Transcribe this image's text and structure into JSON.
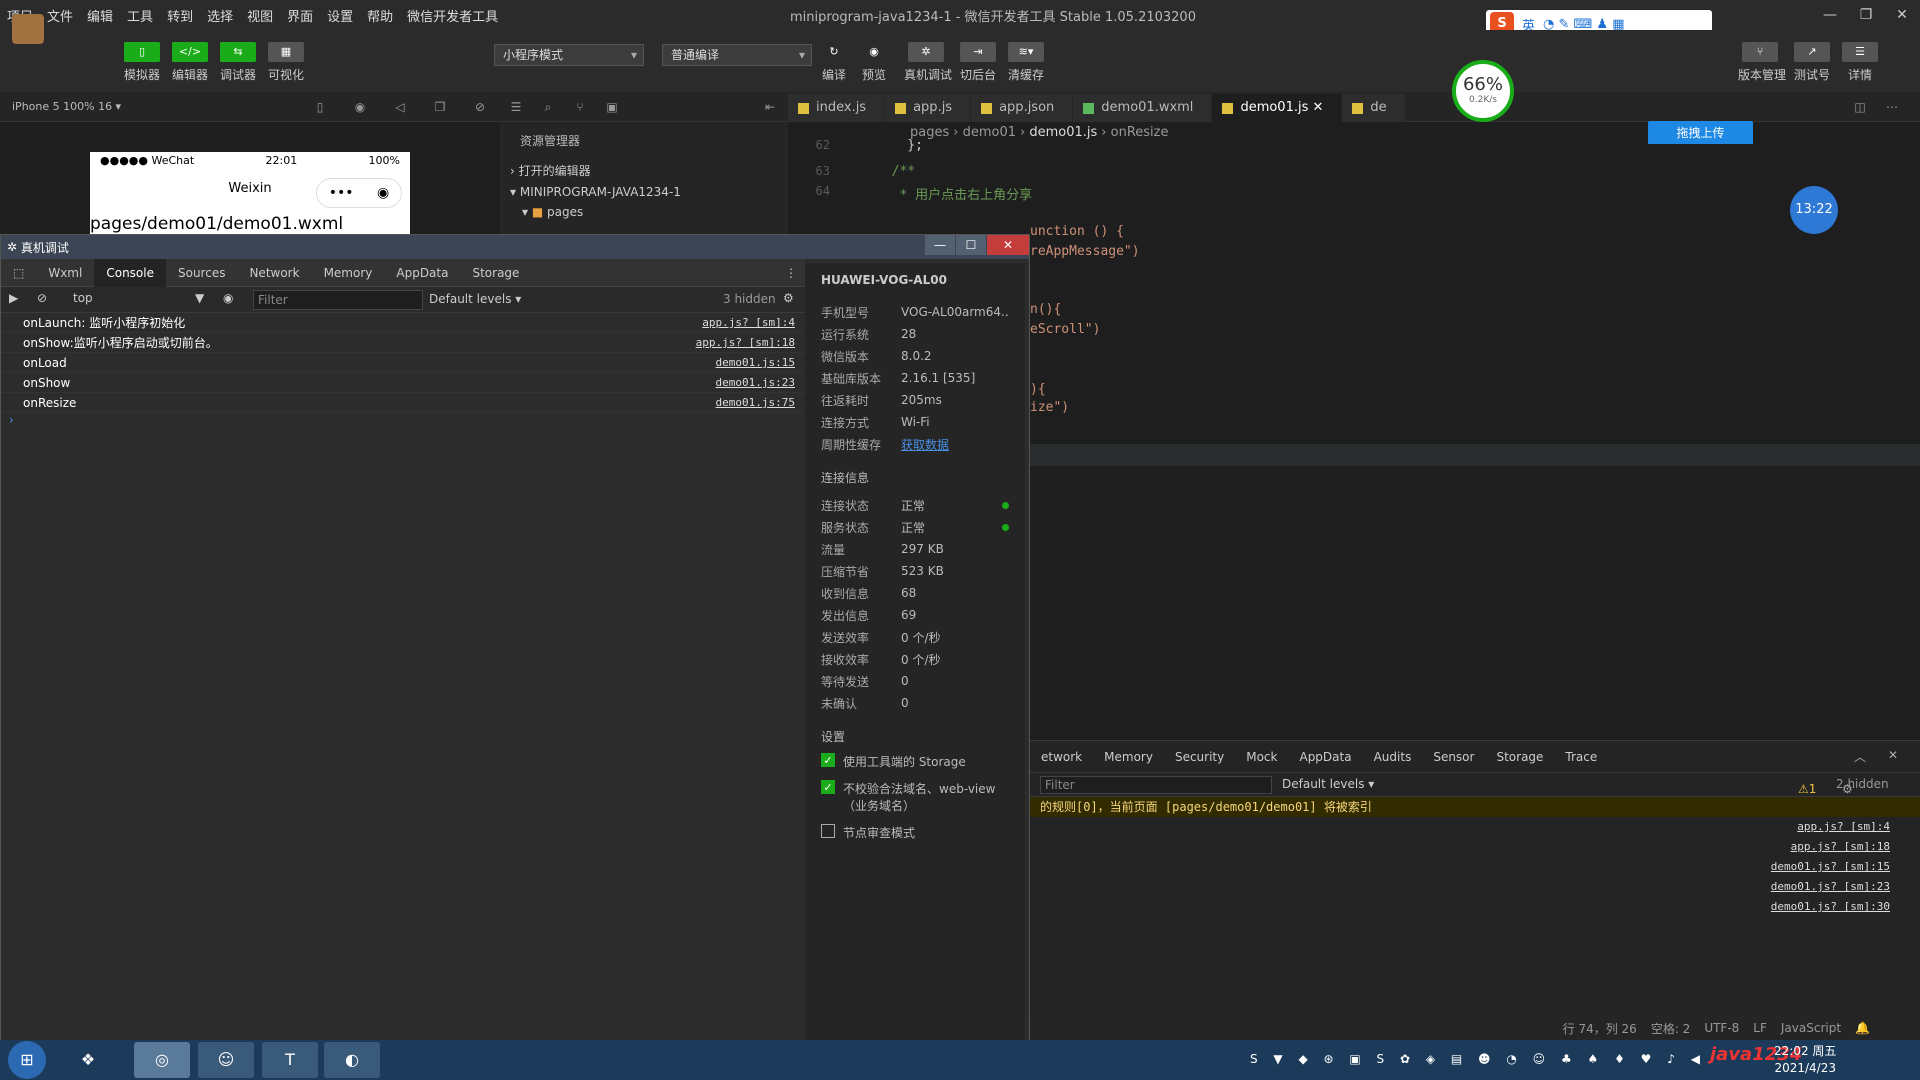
{
  "menu": [
    "项目",
    "文件",
    "编辑",
    "工具",
    "转到",
    "选择",
    "视图",
    "界面",
    "设置",
    "帮助",
    "微信开发者工具"
  ],
  "window_title": "miniprogram-java1234-1 - 微信开发者工具 Stable 1.05.2103200",
  "ime": {
    "label": "英"
  },
  "toolbar": {
    "simulator": "模拟器",
    "editor": "编辑器",
    "debugger": "调试器",
    "visual": "可视化",
    "mode": "小程序模式",
    "compile_mode": "普通编译",
    "compile": "编译",
    "preview": "预览",
    "real_debug": "真机调试",
    "backstage": "切后台",
    "clear_cache": "清缓存",
    "version": "版本管理",
    "test": "测试号",
    "detail": "详情"
  },
  "device": "iPhone 5 100% 16 ▾",
  "tabs": [
    {
      "label": "index.js",
      "color": "#e0c040"
    },
    {
      "label": "app.js",
      "color": "#e0c040"
    },
    {
      "label": "app.json",
      "color": "#e0c040"
    },
    {
      "label": "demo01.wxml",
      "color": "#5cb85c"
    },
    {
      "label": "demo01.js",
      "color": "#e0c040"
    },
    {
      "label": "de",
      "color": "#e0c040"
    }
  ],
  "breadcrumb": [
    "pages",
    "demo01",
    "demo01.js",
    "onResize"
  ],
  "upload": "拖拽上传",
  "perf": {
    "percent": "66%",
    "speed": "0.2K/s"
  },
  "clock": "13:22",
  "phone": {
    "carrier": "●●●●● WeChat",
    "time": "22:01",
    "battery": "100%",
    "title": "Weixin",
    "path": "pages/demo01/demo01.wxml"
  },
  "explorer": {
    "header": "资源管理器",
    "open_editors": "打开的编辑器",
    "project": "MINIPROGRAM-JAVA1234-1",
    "folder": "pages"
  },
  "code": [
    {
      "n": "62",
      "t": "    };"
    },
    {
      "n": "63",
      "t": "  /**"
    },
    {
      "n": "64",
      "t": "   * 用户点击右上角分享"
    },
    {
      "n": "",
      "t": "unction () {"
    },
    {
      "n": "",
      "t": "reAppMessage\")"
    },
    {
      "n": "",
      "t": "n(){"
    },
    {
      "n": "",
      "t": "eScroll\")"
    },
    {
      "n": "",
      "t": "){"
    },
    {
      "n": "",
      "t": "ize\")"
    }
  ],
  "debug": {
    "title": "真机调试",
    "tabs": [
      "Wxml",
      "Console",
      "Sources",
      "Network",
      "Memory",
      "AppData",
      "Storage"
    ],
    "context": "top",
    "filter": "Filter",
    "levels": "Default levels ▾",
    "hidden": "3 hidden",
    "logs": [
      {
        "msg": "onLaunch: 监听小程序初始化",
        "src": "app.js? [sm]:4"
      },
      {
        "msg": "onShow:监听小程序启动或切前台。",
        "src": "app.js? [sm]:18"
      },
      {
        "msg": "onLoad",
        "src": "demo01.js:15"
      },
      {
        "msg": "onShow",
        "src": "demo01.js:23"
      },
      {
        "msg": "onResize",
        "src": "demo01.js:75"
      }
    ],
    "prompt": "›",
    "device_name": "HUAWEI-VOG-AL00",
    "info": [
      {
        "k": "手机型号",
        "v": "VOG-AL00arm64..."
      },
      {
        "k": "运行系统",
        "v": "28"
      },
      {
        "k": "微信版本",
        "v": "8.0.2"
      },
      {
        "k": "基础库版本",
        "v": "2.16.1 [535]"
      },
      {
        "k": "往返耗时",
        "v": "205ms"
      },
      {
        "k": "连接方式",
        "v": "Wi-Fi"
      },
      {
        "k": "周期性缓存",
        "v": "获取数据"
      }
    ],
    "conn_title": "连接信息",
    "conn": [
      {
        "k": "连接状态",
        "v": "正常"
      },
      {
        "k": "服务状态",
        "v": "正常"
      },
      {
        "k": "流量",
        "v": "297 KB"
      },
      {
        "k": "压缩节省",
        "v": "523 KB"
      },
      {
        "k": "收到信息",
        "v": "68"
      },
      {
        "k": "发出信息",
        "v": "69"
      },
      {
        "k": "发送效率",
        "v": "0 个/秒"
      },
      {
        "k": "接收效率",
        "v": "0 个/秒"
      },
      {
        "k": "等待发送",
        "v": "0"
      },
      {
        "k": "未确认",
        "v": "0"
      }
    ],
    "settings_title": "设置",
    "settings": [
      {
        "label": "使用工具端的 Storage",
        "checked": true
      },
      {
        "label": "不校验合法域名、web-view（业务域名）",
        "checked": true
      },
      {
        "label": "节点审查模式",
        "checked": false
      }
    ]
  },
  "bottom": {
    "tabs": [
      "etwork",
      "Memory",
      "Security",
      "Mock",
      "AppData",
      "Audits",
      "Sensor",
      "Storage",
      "Trace"
    ],
    "warn_count": "⚠1",
    "filter": "Filter",
    "levels": "Default levels ▾",
    "hidden": "2 hidden",
    "warning": "的规则[0]，当前页面 [pages/demo01/demo01] 将被索引",
    "sources": [
      "app.js? [sm]:4",
      "app.js? [sm]:18",
      "demo01.js? [sm]:15",
      "demo01.js? [sm]:23",
      "demo01.js? [sm]:30"
    ]
  },
  "status": {
    "pos": "行 74，列 26",
    "space": "空格: 2",
    "enc": "UTF-8",
    "eol": "LF",
    "lang": "JavaScript"
  },
  "taskbar": {
    "time": "22:02 周五",
    "date": "2021/4/23",
    "watermark": "java1234"
  }
}
